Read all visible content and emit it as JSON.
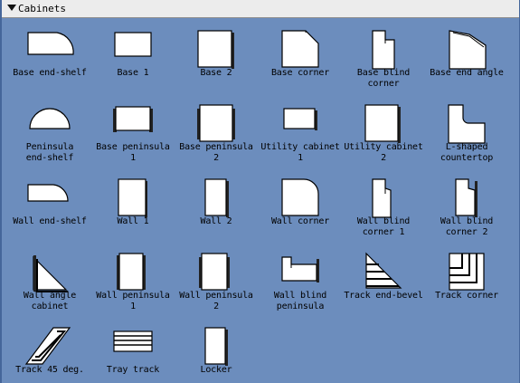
{
  "panel": {
    "title": "Cabinets"
  },
  "shapes": [
    {
      "label": "Base end-shelf",
      "icon": "base-end-shelf-icon"
    },
    {
      "label": "Base 1",
      "icon": "base-1-icon"
    },
    {
      "label": "Base 2",
      "icon": "base-2-icon"
    },
    {
      "label": "Base corner",
      "icon": "base-corner-icon"
    },
    {
      "label": "Base blind\ncorner",
      "icon": "base-blind-corner-icon"
    },
    {
      "label": "Base end angle",
      "icon": "base-end-angle-icon"
    },
    {
      "label": "Peninsula\nend-shelf",
      "icon": "peninsula-end-shelf-icon"
    },
    {
      "label": "Base peninsula\n1",
      "icon": "base-peninsula-1-icon"
    },
    {
      "label": "Base peninsula\n2",
      "icon": "base-peninsula-2-icon"
    },
    {
      "label": "Utility cabinet\n1",
      "icon": "utility-cabinet-1-icon"
    },
    {
      "label": "Utility cabinet\n2",
      "icon": "utility-cabinet-2-icon"
    },
    {
      "label": "L-shaped\ncountertop",
      "icon": "l-shaped-countertop-icon"
    },
    {
      "label": "Wall end-shelf",
      "icon": "wall-end-shelf-icon"
    },
    {
      "label": "Wall 1",
      "icon": "wall-1-icon"
    },
    {
      "label": "Wall 2",
      "icon": "wall-2-icon"
    },
    {
      "label": "Wall corner",
      "icon": "wall-corner-icon"
    },
    {
      "label": "Wall blind\ncorner 1",
      "icon": "wall-blind-corner-1-icon"
    },
    {
      "label": "Wall blind\ncorner 2",
      "icon": "wall-blind-corner-2-icon"
    },
    {
      "label": "Wall angle\ncabinet",
      "icon": "wall-angle-cabinet-icon"
    },
    {
      "label": "Wall peninsula\n1",
      "icon": "wall-peninsula-1-icon"
    },
    {
      "label": "Wall peninsula\n2",
      "icon": "wall-peninsula-2-icon"
    },
    {
      "label": "Wall blind\npeninsula",
      "icon": "wall-blind-peninsula-icon"
    },
    {
      "label": "Track end-bevel",
      "icon": "track-end-bevel-icon"
    },
    {
      "label": "Track corner",
      "icon": "track-corner-icon"
    },
    {
      "label": "Track 45 deg.",
      "icon": "track-45-deg-icon"
    },
    {
      "label": "Tray track",
      "icon": "tray-track-icon"
    },
    {
      "label": "Locker",
      "icon": "locker-icon"
    }
  ]
}
